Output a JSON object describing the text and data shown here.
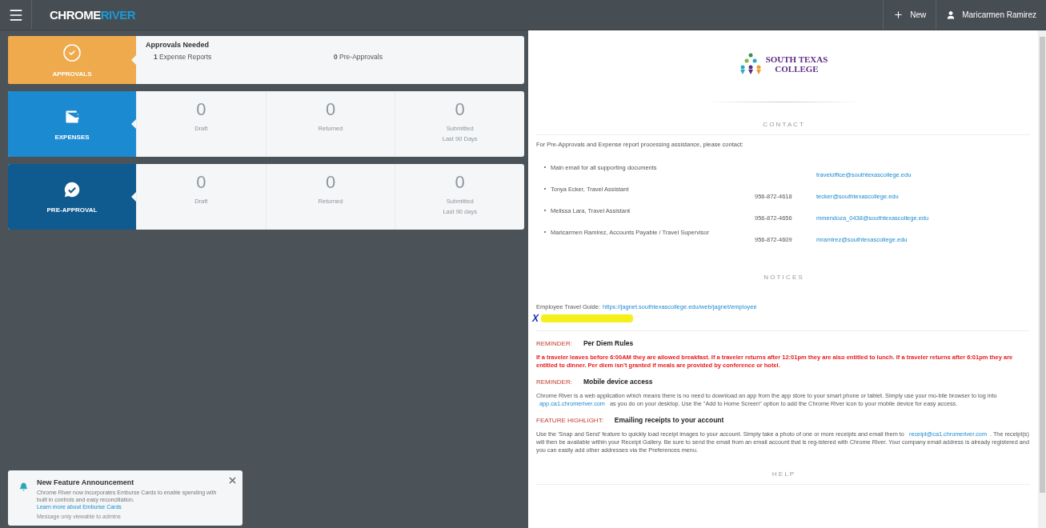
{
  "topbar": {
    "brand": [
      "CHROME",
      "RIVER"
    ],
    "new_label": "New",
    "user": "Maricarmen Ramirez"
  },
  "tiles": [
    {
      "kind": "approvals",
      "label": "APPROVALS",
      "color": "#eeaa4c",
      "heading": "Approvals Needed",
      "items": [
        {
          "count": "1",
          "label": "Expense Reports"
        },
        {
          "count": "0",
          "label": "Pre-Approvals"
        }
      ]
    },
    {
      "kind": "counts",
      "label": "EXPENSES",
      "color": "#1b8ad0",
      "stats": [
        {
          "value": "0",
          "label": "Draft"
        },
        {
          "value": "0",
          "label": "Returned"
        },
        {
          "value": "0",
          "label": "Submitted\nLast 90 Days"
        }
      ]
    },
    {
      "kind": "counts",
      "label": "PRE-APPROVAL",
      "color": "#0f5a8f",
      "stats": [
        {
          "value": "0",
          "label": "Draft"
        },
        {
          "value": "0",
          "label": "Returned"
        },
        {
          "value": "0",
          "label": "Submitted\nLast 90 days"
        }
      ]
    }
  ],
  "toast": {
    "title": "New Feature Announcement",
    "body": "Chrome River now incorporates Emburse Cards to enable spending with built in controls and easy reconciliation.",
    "link": "Learn more about Emburse Cards",
    "note": "Message only viewable to admins"
  },
  "panel": {
    "logo": [
      "SOUTH TEXAS",
      "COLLEGE"
    ],
    "contact_heading": "C O N T A C T",
    "contact_intro": "For Pre-Approvals and Expense report processing assistance, please contact:",
    "contacts": [
      {
        "name": "Main email for all supporting documents",
        "email": "traveloffice@southtexascollege.edu"
      },
      {
        "name": "Tonya Ecker, Travel Assistant",
        "phone": "956-872-4618",
        "email": "tecker@southtexascollege.edu"
      },
      {
        "name": "Melissa Lara, Travel Assistant",
        "phone": "956-872-4656",
        "email": "mmendoza_0438@southtexascollege.edu"
      },
      {
        "name": "Maricarmen Ramirez, Accounts Payable / Travel Supervisor",
        "phone": "956-872-4609",
        "email": "mramirez@southtexascollege.edu"
      }
    ],
    "notices_heading": "N O T I C E S",
    "guide_label": "Employee Travel Guide:",
    "guide_link": "https://jagnet.southtexascollege.edu/web/jagnet/employee",
    "annotation_mark": "X",
    "notices": [
      {
        "tag": "REMINDER:",
        "title": "Per Diem Rules",
        "alert": true,
        "parts": [
          {
            "kind": "text",
            "text": "If a traveler leaves before 6:00AM they are allowed breakfast. If a traveler returns after 12:01pm they are also entitled to lunch. If a traveler returns after 6:01pm they are entitled to dinner. Per diem isn't granted if meals are provided by conference or hotel."
          }
        ]
      },
      {
        "tag": "REMINDER:",
        "title": "Mobile device access",
        "alert": false,
        "parts": [
          {
            "kind": "text",
            "text": "Chrome River is a web application which means there is no need to download an app from the app store to your smart phone or tablet.  Simply use your mo-bile browser to log into "
          },
          {
            "kind": "link",
            "text": "app.ca1.chromeriver.com"
          },
          {
            "kind": "text",
            "text": " as you do on your desktop.  Use the \"Add to Home Screen\" option to add the Chrome River icon to your mobile device for easy access."
          }
        ]
      },
      {
        "tag": "FEATURE HIGHLIGHT:",
        "title": "Emailing receipts to your account",
        "alert": false,
        "parts": [
          {
            "kind": "text",
            "text": "Use the 'Snap and Send' feature to quickly load receipt images to your account.  Simply take a photo of one or more receipts and email them to "
          },
          {
            "kind": "link",
            "text": "receipt@ca1.chromeriver.com"
          },
          {
            "kind": "text",
            "text": ".  The receipt(s) will then be available within your Receipt Gallery.  Be sure to send the email from an email account that is reg-istered with Chrome River.  Your company email address is already registered and you can easily add other addresses via the Preferences menu."
          }
        ]
      }
    ],
    "help_heading": "H E L P"
  }
}
